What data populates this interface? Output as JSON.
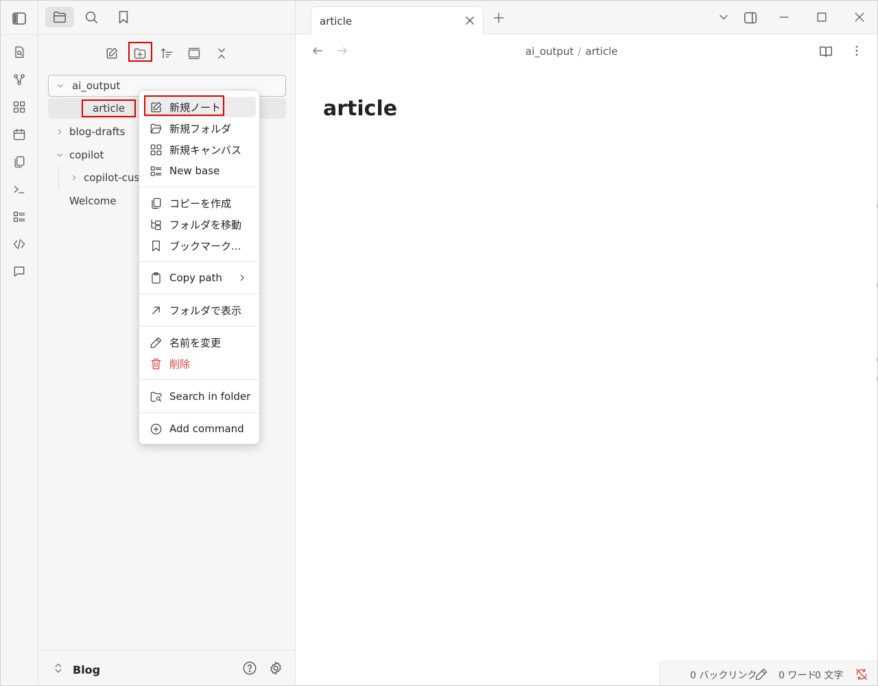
{
  "sidebar": {
    "tree": {
      "folder_ai_output": "ai_output",
      "file_article": "article",
      "folder_blog_drafts": "blog-drafts",
      "folder_copilot": "copilot",
      "folder_copilot_custom": "copilot-cus",
      "file_welcome": "Welcome"
    },
    "vault_name": "Blog"
  },
  "context_menu": {
    "new_note": "新規ノート",
    "new_folder": "新規フォルダ",
    "new_canvas": "新規キャンバス",
    "new_base": "New base",
    "make_copy": "コピーを作成",
    "move_folder": "フォルダを移動",
    "bookmark": "ブックマーク...",
    "copy_path": "Copy path",
    "show_in_folder": "フォルダで表示",
    "rename": "名前を変更",
    "delete": "削除",
    "search_in_folder": "Search in folder",
    "add_command": "Add command"
  },
  "tabs": [
    {
      "title": "article"
    }
  ],
  "breadcrumb": {
    "folder": "ai_output",
    "separator": "/",
    "file": "article"
  },
  "document": {
    "title": "article"
  },
  "status": {
    "backlinks": "0 バックリンク",
    "words": "0 ワード",
    "chars": "0 文字"
  },
  "colors": {
    "highlight_box": "#e00000",
    "danger": "#e03e3e",
    "sidebar_bg": "#f6f6f6"
  }
}
